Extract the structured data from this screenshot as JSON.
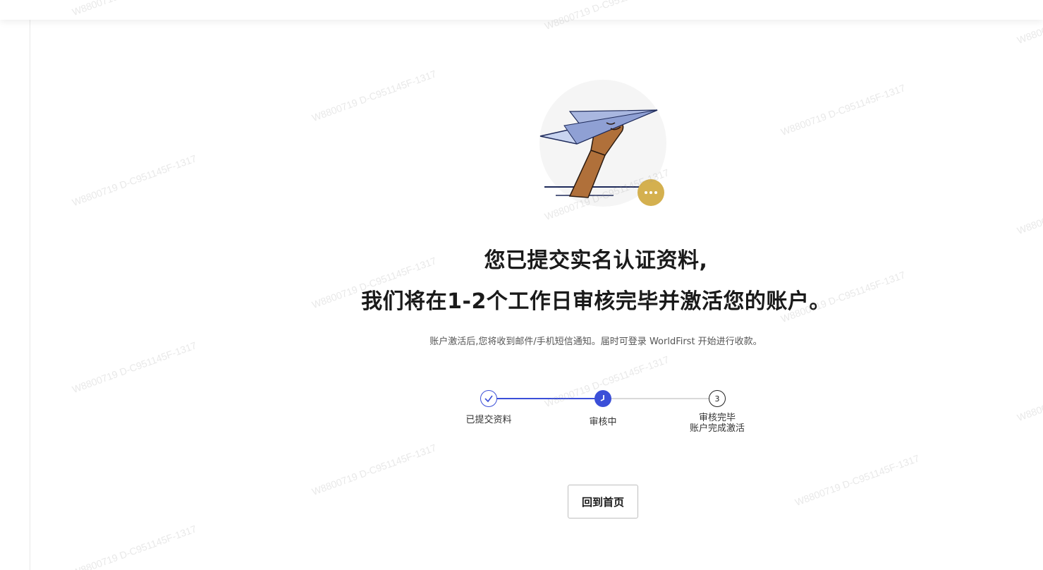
{
  "page": {
    "headline_line1": "您已提交实名认证资料,",
    "headline_line2": "我们将在1-2个工作日审核完毕并激活您的账户。",
    "subtext": "账户激活后,您将收到邮件/手机短信通知。届时可登录 WorldFirst 开始进行收款。"
  },
  "illustration": {
    "icon": "paper-plane-hand-illustration",
    "badge_icon": "more-dots-icon",
    "badge_color": "#d4b04f",
    "circle_color": "#f5f5f5"
  },
  "stepper": {
    "accent": "#3b4fd8",
    "steps": [
      {
        "label": "已提交资料",
        "state": "done",
        "icon": "check-icon"
      },
      {
        "label": "审核中",
        "state": "current",
        "icon": "clock-icon"
      },
      {
        "label": "审核完毕\n账户完成激活",
        "label_line1": "审核完毕",
        "label_line2": "账户完成激活",
        "state": "pending",
        "number": "3"
      }
    ]
  },
  "actions": {
    "home_label": "回到首页"
  },
  "watermark": {
    "text": "W8800719 D-C951145F-1317"
  }
}
